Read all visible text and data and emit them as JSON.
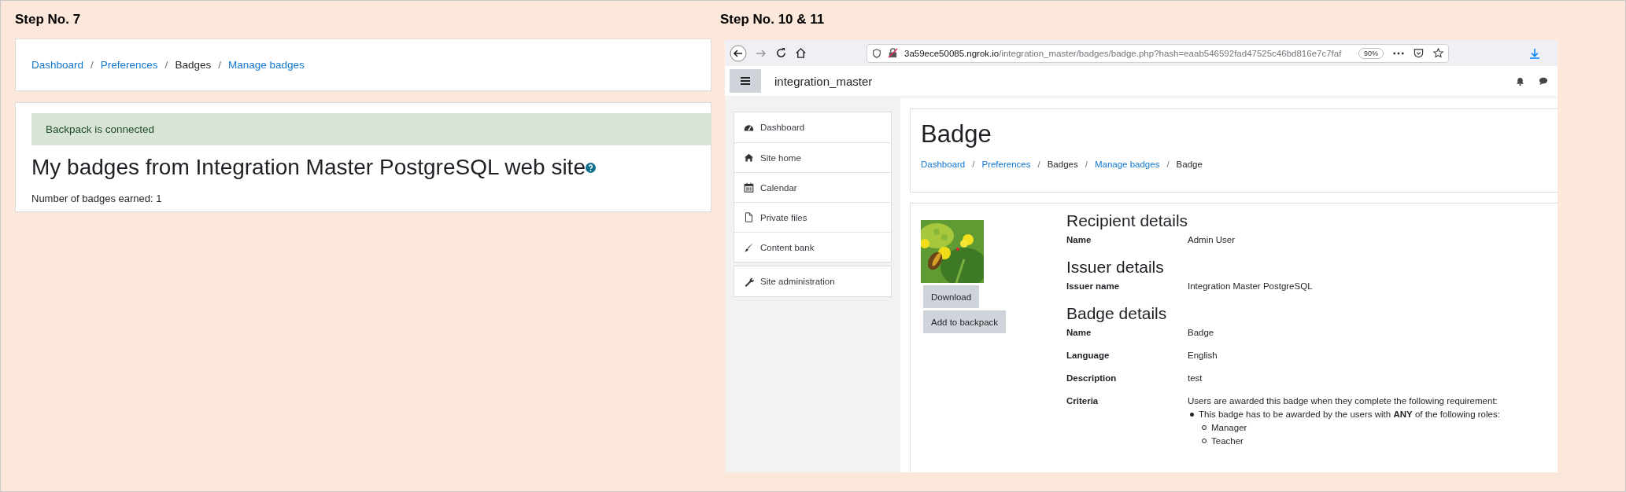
{
  "steps": [
    {
      "label": "Step No. 7"
    },
    {
      "label": "Step No. 10 & 11"
    }
  ],
  "left_page": {
    "breadcrumb": [
      {
        "text": "Dashboard",
        "link": true
      },
      {
        "separator": "/",
        "text": "Preferences",
        "link": true
      },
      {
        "separator": "/",
        "text": "Badges",
        "link": false
      },
      {
        "separator": "/",
        "text": "Manage badges",
        "link": true
      }
    ],
    "alert": "Backpack is connected",
    "title": "My badges from Integration Master PostgreSQL web site",
    "summary": "Number of badges earned: 1"
  },
  "browser": {
    "url_host": "3a59ece50085.ngrok.io",
    "url_path": "/integration_master/badges/badge.php?hash=eaab546592fad47525c46bd816e7c7faf",
    "zoom": "90%"
  },
  "site": {
    "name": "integration_master",
    "nav": [
      [
        {
          "label": "Dashboard"
        },
        {
          "label": "Site home"
        },
        {
          "label": "Calendar"
        },
        {
          "label": "Private files"
        },
        {
          "label": "Content bank"
        }
      ],
      [
        {
          "label": "Site administration"
        }
      ]
    ],
    "title": "Badge",
    "breadcrumb": [
      {
        "text": "Dashboard",
        "link": true
      },
      {
        "separator": "/",
        "text": "Preferences",
        "link": true
      },
      {
        "separator": "/",
        "text": "Badges",
        "link": false
      },
      {
        "separator": "/",
        "text": "Manage badges",
        "link": true
      },
      {
        "separator": "/",
        "text": "Badge",
        "link": false
      }
    ]
  },
  "badge": {
    "buttons": [
      "Download",
      "Add to backpack"
    ],
    "sections": [
      {
        "heading": "Recipient details",
        "rows": [
          {
            "label": "Name",
            "value": "Admin User"
          }
        ]
      },
      {
        "heading": "Issuer details",
        "rows": [
          {
            "label": "Issuer name",
            "value": "Integration Master PostgreSQL"
          }
        ]
      },
      {
        "heading": "Badge details",
        "rows": [
          {
            "label": "Name",
            "value": "Badge"
          },
          {
            "label": "Language",
            "value": "English"
          },
          {
            "label": "Description",
            "value": "test"
          },
          {
            "label": "Criteria",
            "value": "Users are awarded this badge when they complete the following requirement:",
            "requirement": "This badge has to be awarded by the users with **ANY** of the following roles:",
            "roles": [
              "Manager",
              "Teacher"
            ]
          }
        ]
      }
    ]
  }
}
